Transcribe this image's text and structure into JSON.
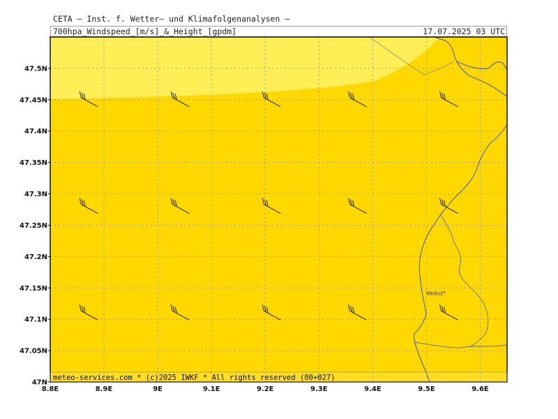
{
  "header": {
    "title": "CETA — Inst. f. Wetter— und Klimafolgenanalysen —",
    "parameter": "700hpa_Windspeed_[m/s]_&_Height_[gpdm]",
    "datetime": "17.07.2025 03 UTC"
  },
  "footer": {
    "credit": "meteo-services.com * (c)2025 IWKF * All rights reserved (00+027)"
  },
  "map": {
    "lon_range": [
      8.8,
      9.65
    ],
    "lat_range": [
      47.0,
      47.55
    ],
    "x_ticks": [
      {
        "value": 8.8,
        "label": "8.8E"
      },
      {
        "value": 8.9,
        "label": "8.9E"
      },
      {
        "value": 9.0,
        "label": "9E"
      },
      {
        "value": 9.1,
        "label": "9.1E"
      },
      {
        "value": 9.2,
        "label": "9.2E"
      },
      {
        "value": 9.3,
        "label": "9.3E"
      },
      {
        "value": 9.4,
        "label": "9.4E"
      },
      {
        "value": 9.5,
        "label": "9.5E"
      },
      {
        "value": 9.6,
        "label": "9.6E"
      }
    ],
    "y_ticks": [
      {
        "value": 47.0,
        "label": "47N"
      },
      {
        "value": 47.05,
        "label": "47.05N"
      },
      {
        "value": 47.1,
        "label": "47.1N"
      },
      {
        "value": 47.15,
        "label": "47.15N"
      },
      {
        "value": 47.2,
        "label": "47.2N"
      },
      {
        "value": 47.25,
        "label": "47.25N"
      },
      {
        "value": 47.3,
        "label": "47.3N"
      },
      {
        "value": 47.35,
        "label": "47.35N"
      },
      {
        "value": 47.4,
        "label": "47.4N"
      },
      {
        "value": 47.45,
        "label": "47.45N"
      },
      {
        "value": 47.5,
        "label": "47.5N"
      }
    ],
    "colors": {
      "fill_main": "#ffd800",
      "fill_light": "#ffee55",
      "fill_bottom": "#ffdd22",
      "grid": "#9999aa",
      "border": "#5a6a9a",
      "barb": "#222222",
      "city_dot": "#ff4444"
    },
    "city": {
      "name": "Vaduz",
      "lon": 9.52,
      "lat": 47.14
    },
    "wind_barbs": [
      {
        "lon": 8.86,
        "lat": 47.45
      },
      {
        "lon": 9.03,
        "lat": 47.45
      },
      {
        "lon": 9.2,
        "lat": 47.45
      },
      {
        "lon": 9.36,
        "lat": 47.45
      },
      {
        "lon": 9.53,
        "lat": 47.45
      },
      {
        "lon": 8.86,
        "lat": 47.28
      },
      {
        "lon": 9.03,
        "lat": 47.28
      },
      {
        "lon": 9.2,
        "lat": 47.28
      },
      {
        "lon": 9.36,
        "lat": 47.28
      },
      {
        "lon": 9.53,
        "lat": 47.28
      },
      {
        "lon": 8.86,
        "lat": 47.11
      },
      {
        "lon": 9.03,
        "lat": 47.11
      },
      {
        "lon": 9.2,
        "lat": 47.11
      },
      {
        "lon": 9.36,
        "lat": 47.11
      },
      {
        "lon": 9.53,
        "lat": 47.11
      }
    ]
  }
}
